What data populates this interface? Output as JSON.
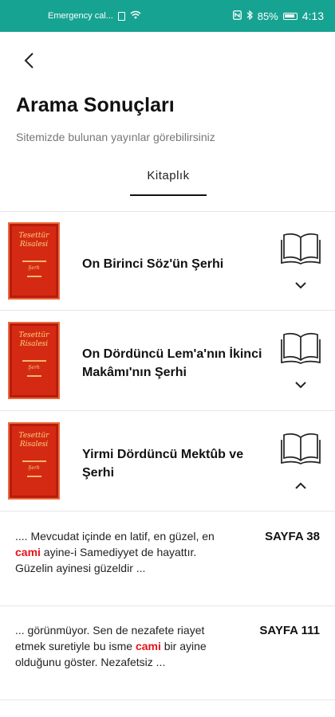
{
  "status_bar": {
    "carrier": "Emergency cal...",
    "battery": "85%",
    "time": "4:13"
  },
  "header": {
    "back_icon": "chevron-left-icon",
    "title": "Arama Sonuçları",
    "subtitle": "Sitemizde bulunan yayınlar görebilirsiniz"
  },
  "tabs": [
    {
      "label": "Kitaplık",
      "selected": true
    }
  ],
  "books": [
    {
      "title": "On Birinci Söz'ün Şerhi",
      "cover_line1": "Tesettür",
      "cover_line2": "Risalesi",
      "cover_line3": "Şerh",
      "expanded": false
    },
    {
      "title": "On Dördüncü Lem'a'nın İkinci Makâmı'nın Şerhi",
      "cover_line1": "Tesettür",
      "cover_line2": "Risalesi",
      "cover_line3": "Şerh",
      "expanded": false
    },
    {
      "title": "Yirmi Dördüncü Mektûb ve Şerhi",
      "cover_line1": "Tesettür",
      "cover_line2": "Risalesi",
      "cover_line3": "Şerh",
      "expanded": true
    }
  ],
  "results": [
    {
      "before": ".... Mevcudat içinde en latif, en güzel, en ",
      "highlight": "cami",
      "after": " ayine-i Samediyyet de hayattır. Güzelin ayinesi güzeldir ...",
      "page": "SAYFA 38"
    },
    {
      "before": "... görünmüyor. Sen de nezafete riayet etmek suretiyle bu isme ",
      "highlight": "cami",
      "after": " bir ayine olduğunu göster. Nezafetsiz ...",
      "page": "SAYFA 111"
    }
  ],
  "colors": {
    "status_bar": "#17a392",
    "highlight": "#e5141c",
    "cover": "#d42a14"
  }
}
